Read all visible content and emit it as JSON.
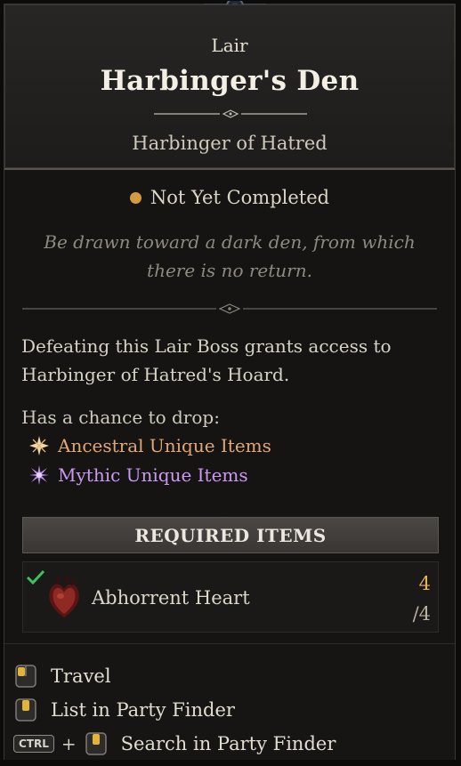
{
  "header": {
    "type_label": "Lair",
    "title": "Harbinger's Den",
    "subtitle": "Harbinger of Hatred"
  },
  "status": {
    "label": "Not Yet Completed",
    "dot_color": "#d39a3e"
  },
  "flavor_text": {
    "line1": "Be drawn toward a dark den, from which",
    "line2": "there is no return."
  },
  "description": {
    "line1": "Defeating this Lair Boss grants access to",
    "line2": "Harbinger of Hatred's Hoard."
  },
  "drops": {
    "label": "Has a chance to drop:",
    "items": [
      {
        "label": "Ancestral Unique Items",
        "color": "#e0a777",
        "icon": "ancestral-star-icon"
      },
      {
        "label": "Mythic Unique Items",
        "color": "#c99af0",
        "icon": "mythic-star-icon"
      }
    ]
  },
  "required": {
    "header": "REQUIRED ITEMS",
    "items": [
      {
        "name": "Abhorrent Heart",
        "have": "4",
        "need": "/4",
        "icon": "abhorrent-heart-icon",
        "complete": true
      }
    ]
  },
  "actions": {
    "travel": "Travel",
    "party_finder": "List in Party Finder",
    "ctrl_key": "CTRL",
    "plus": "+",
    "search_party": "Search in Party Finder"
  }
}
